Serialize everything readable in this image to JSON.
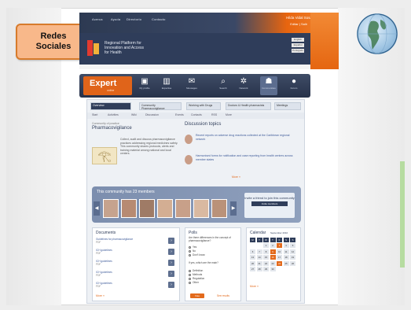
{
  "callout": {
    "line1": "Redes",
    "line2": "Sociales"
  },
  "topbar": {
    "nav": [
      "Acerca",
      "Ayuda",
      "Directorio",
      "Contacto"
    ],
    "user_name": "Hilda Vidal Sosa",
    "user_links": "Editar | Salir"
  },
  "banner": {
    "title_line1": "Regional Platform for",
    "title_line2": "Innovation and Access",
    "title_line3": "for Health",
    "buttons": [
      "English",
      "Español",
      "Português"
    ]
  },
  "toolbar": {
    "logo": "Expert",
    "logo_sub": "online",
    "items": [
      {
        "label": "My profile",
        "icon": "profile-icon"
      },
      {
        "label": "Expertise",
        "icon": "books-icon"
      },
      {
        "label": "Messages",
        "icon": "inbox-icon"
      },
      {
        "label": "Search",
        "icon": "search-doc-icon"
      },
      {
        "label": "Network",
        "icon": "network-icon"
      },
      {
        "label": "Communities",
        "icon": "people-icon"
      },
      {
        "label": "Forum",
        "icon": "speech-icon"
      }
    ]
  },
  "page": {
    "tabs": [
      "Overview",
      "Community Pharmacovigilance",
      "Working with Drugs",
      "Doctors & Health pharmacists",
      "Meetings"
    ],
    "subtabs": [
      "Start",
      "Activities",
      "Wiki",
      "Discussion",
      "Events",
      "Contacts",
      "RSS",
      "More"
    ],
    "left_title": "Pharmacovigilance",
    "left_meta": "Community of practice",
    "left_para": "Collect, audit and discuss pharmacovigilance practices addressing regional medicines safety. This community shares protocols, alerts and training material among national and local centers.",
    "discussion_title": "Discussion topics",
    "posts": [
      "Recent reports on adverse drug reactions collected at the Caribbean regional network",
      "Harmonised forms for notification and case reporting from health centres across member states"
    ],
    "more": "More »",
    "community_title": "This community has 23 members",
    "invite_text": "Invite a friend to join this community",
    "invite_button": "Invite members",
    "documents_title": "Documents",
    "documents": [
      {
        "title": "Guidelines for pharmacovigilance",
        "meta": "PDF"
      },
      {
        "title": "ICH guidelines",
        "meta": "PDF"
      },
      {
        "title": "ICH guidelines",
        "meta": "PDF"
      },
      {
        "title": "ICH guidelines",
        "meta": "PDF"
      },
      {
        "title": "ICH guidelines",
        "meta": "PDF"
      }
    ],
    "poll_title": "Polls",
    "poll_question": "Are there differences in the concept of pharmacovigilance?",
    "poll_options": [
      "Yes",
      "No",
      "Don't know"
    ],
    "poll_question2": "If yes, which are the main?",
    "poll_options2": [
      "Definition",
      "Methods",
      "Regulation",
      "Other"
    ],
    "vote": "Vote",
    "results": "See results",
    "calendar_title": "Calendar",
    "calendar_month": "September 2010",
    "calendar_days": [
      "M",
      "T",
      "W",
      "T",
      "F",
      "S",
      "S"
    ],
    "calendar_numbers": [
      "1",
      "2",
      "3",
      "4",
      "5",
      "6",
      "7",
      "8",
      "9",
      "10",
      "11",
      "12",
      "13",
      "14",
      "15",
      "16",
      "17",
      "18",
      "19",
      "20",
      "21",
      "22",
      "23",
      "24",
      "25",
      "26",
      "27",
      "28",
      "29",
      "30"
    ]
  }
}
